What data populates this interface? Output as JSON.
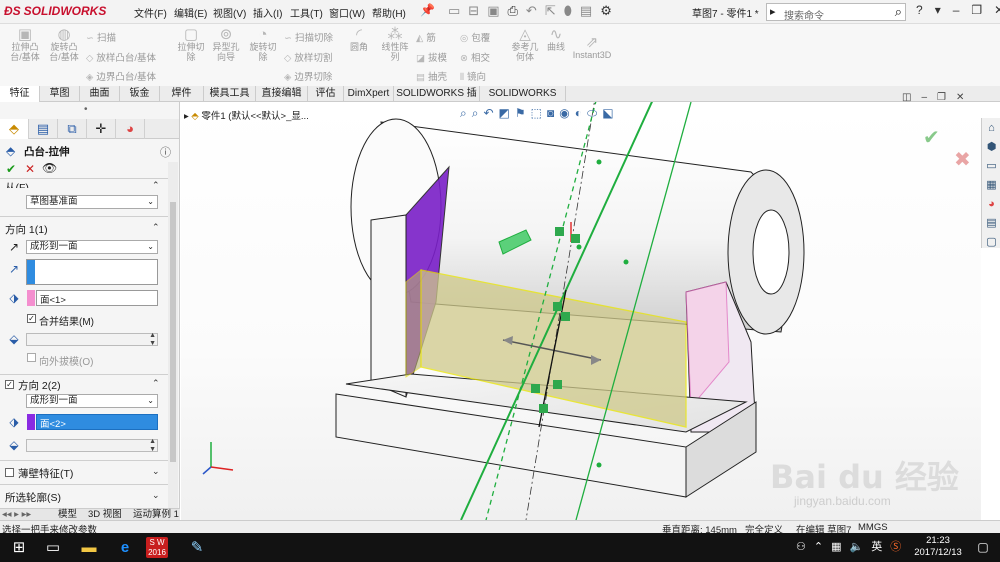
{
  "titlebar": {
    "logo": "SOLIDWORKS",
    "menus": [
      "文件(F)",
      "编辑(E)",
      "视图(V)",
      "插入(I)",
      "工具(T)",
      "窗口(W)",
      "帮助(H)"
    ],
    "doc_title": "草图7 - 零件1 *",
    "search_placeholder": "搜索命令"
  },
  "command_manager": {
    "large": [
      {
        "label": "拉伸凸\n台/基体",
        "icon": "extruded-boss-icon"
      },
      {
        "label": "旋转凸\n台/基体",
        "icon": "revolved-boss-icon"
      },
      {
        "label": "拉伸切\n除",
        "icon": "extruded-cut-icon"
      },
      {
        "label": "异型孔\n向导",
        "icon": "hole-wizard-icon"
      },
      {
        "label": "旋转切\n除",
        "icon": "revolved-cut-icon"
      },
      {
        "label": "圆角",
        "icon": "fillet-icon"
      },
      {
        "label": "线性阵\n列",
        "icon": "linear-pattern-icon"
      },
      {
        "label": "参考几\n何体",
        "icon": "reference-geometry-icon"
      },
      {
        "label": "曲线",
        "icon": "curves-icon"
      },
      {
        "label": "Instant3D",
        "icon": "instant3d-icon"
      }
    ],
    "small": [
      "扫描",
      "放样凸台/基体",
      "边界凸台/基体",
      "扫描切除",
      "放样切割",
      "边界切除",
      "筋",
      "拔模",
      "抽壳",
      "包覆",
      "相交",
      "镜向"
    ]
  },
  "tabs": [
    "特征",
    "草图",
    "曲面",
    "钣金",
    "焊件",
    "模具工具",
    "直接编辑",
    "评估",
    "DimXpert",
    "SOLIDWORKS 插件",
    "SOLIDWORKS MBD"
  ],
  "property_manager": {
    "title": "凸台-拉伸",
    "from_label": "从(F)",
    "from_value": "草图基准面",
    "dir1_label": "方向 1(1)",
    "dir1_type": "成形到一面",
    "dir1_face": "面<1>",
    "merge_label": "合并结果(M)",
    "draft_outward_label": "向外拔模(O)",
    "dir2_label": "方向 2(2)",
    "dir2_type": "成形到一面",
    "dir2_face": "面<2>",
    "thin_label": "薄壁特征(T)",
    "contours_label": "所选轮廓(S)"
  },
  "bottom_tabs": [
    "模型",
    "3D 视图",
    "运动算例 1"
  ],
  "status": {
    "hint": "选择一把手来修改参数",
    "distance": "垂直距离: 145mm",
    "define": "完全定义",
    "editing": "在编辑 草图7",
    "unit": "MMGS"
  },
  "viewport": {
    "tree_root": "零件1 (默认<<默认>_显..."
  },
  "taskbar": {
    "sw_label": "S W\n2016",
    "ime": "英",
    "time": "21:23",
    "date": "2017/12/13"
  },
  "watermark": {
    "text": "Bai du 经验",
    "sub": "jingyan.baidu.com"
  },
  "colors": {
    "accent_red": "#c8102e",
    "selection_blue": "#2f8ce0",
    "face1_chip": "#f48fcf",
    "face2_chip": "#8a2be2",
    "sketch_green": "#1fae3f",
    "preview_yellow": "#e8e400"
  }
}
